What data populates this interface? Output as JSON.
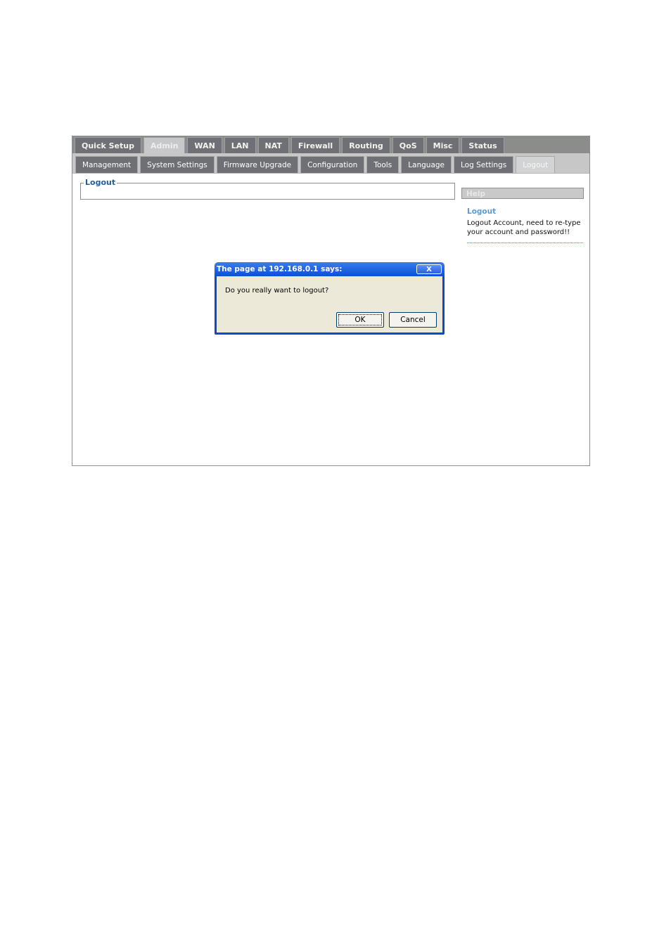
{
  "main_tabs": [
    {
      "label": "Quick Setup",
      "active": false
    },
    {
      "label": "Admin",
      "active": true
    },
    {
      "label": "WAN",
      "active": false
    },
    {
      "label": "LAN",
      "active": false
    },
    {
      "label": "NAT",
      "active": false
    },
    {
      "label": "Firewall",
      "active": false
    },
    {
      "label": "Routing",
      "active": false
    },
    {
      "label": "QoS",
      "active": false
    },
    {
      "label": "Misc",
      "active": false
    },
    {
      "label": "Status",
      "active": false
    }
  ],
  "sub_tabs": [
    {
      "label": "Management",
      "active": false
    },
    {
      "label": "System Settings",
      "active": false
    },
    {
      "label": "Firmware Upgrade",
      "active": false
    },
    {
      "label": "Configuration",
      "active": false
    },
    {
      "label": "Tools",
      "active": false
    },
    {
      "label": "Language",
      "active": false
    },
    {
      "label": "Log Settings",
      "active": false
    },
    {
      "label": "Logout",
      "active": true
    }
  ],
  "section": {
    "legend": "Logout"
  },
  "help": {
    "header": "Help",
    "title": "Logout",
    "text": "Logout Account, need to re-type your account and password!!"
  },
  "dialog": {
    "title": "The page at 192.168.0.1 says:",
    "close_label": "X",
    "message": "Do you really want to logout?",
    "ok_label": "OK",
    "cancel_label": "Cancel"
  },
  "colors": {
    "tab_bg": "#6f7075",
    "tab_active_bg": "#c7c8ca",
    "legend": "#1f5f9e",
    "help_title": "#5b9bd5",
    "dialog_title": "#0a4ad0"
  }
}
